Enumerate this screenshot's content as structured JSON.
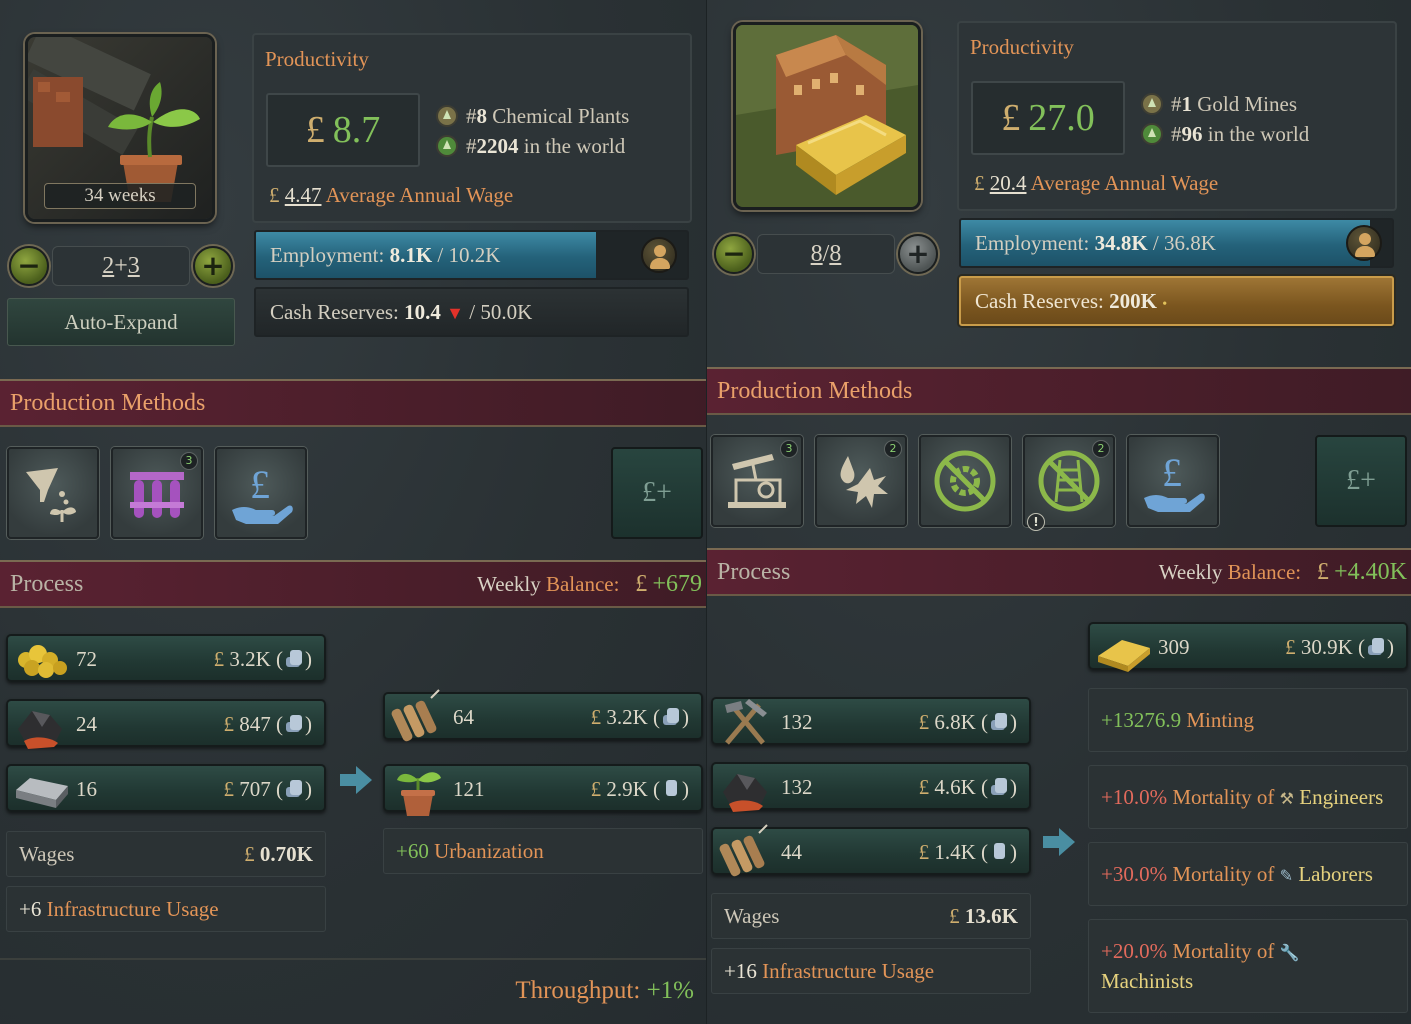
{
  "left": {
    "building_weeks": "34 weeks",
    "level_base": "2",
    "level_sep": "+",
    "level_extra": "3",
    "auto_expand": "Auto-Expand",
    "productivity": {
      "title": "Productivity",
      "currency": "£",
      "value": "8.7",
      "rank_prefix": "#",
      "rank1": "8",
      "rank1_label": "Chemical Plants",
      "rank2": "2204",
      "rank2_label": "in the world",
      "wage_value": "4.47",
      "wage_label": "Average Annual Wage"
    },
    "employment": {
      "label": "Employment:",
      "current": "8.1K",
      "max": "/ 10.2K",
      "fill_fraction": 0.79
    },
    "cash": {
      "label": "Cash Reserves:",
      "current": "10.4",
      "max": "/ 50.0K"
    },
    "production_methods_title": "Production Methods",
    "pm_badges": [
      "3"
    ],
    "process": {
      "title": "Process",
      "balance_label": "Weekly",
      "balance_label2": "Balance:",
      "balance_value": "+679"
    },
    "inputs": [
      {
        "icon": "sulfur-icon",
        "qty": "72",
        "price": "3.2K"
      },
      {
        "icon": "coal-icon",
        "qty": "24",
        "price": "847"
      },
      {
        "icon": "iron-icon",
        "qty": "16",
        "price": "707"
      }
    ],
    "outputs": [
      {
        "icon": "explosives-icon",
        "qty": "64",
        "price": "3.2K"
      },
      {
        "icon": "fertilizer-icon",
        "qty": "121",
        "price": "2.9K"
      }
    ],
    "wages_label": "Wages",
    "wages_value": "0.70K",
    "infra_value": "+6",
    "infra_label": "Infrastructure Usage",
    "urban_value": "+60",
    "urban_label": "Urbanization",
    "throughput_label": "Throughput:",
    "throughput_value": "+1%"
  },
  "right": {
    "level_base": "8",
    "level_sep": "/",
    "level_max": "8",
    "productivity": {
      "title": "Productivity",
      "currency": "£",
      "value": "27.0",
      "rank_prefix": "#",
      "rank1": "1",
      "rank1_label": "Gold Mines",
      "rank2": "96",
      "rank2_label": "in the world",
      "wage_value": "20.4",
      "wage_label": "Average Annual Wage"
    },
    "employment": {
      "label": "Employment:",
      "current": "34.8K",
      "max": "/ 36.8K",
      "fill_fraction": 0.95
    },
    "cash": {
      "label": "Cash Reserves:",
      "current": "200K"
    },
    "production_methods_title": "Production Methods",
    "pm_badges": [
      "3",
      "2",
      "2"
    ],
    "process": {
      "title": "Process",
      "balance_label": "Weekly",
      "balance_label2": "Balance:",
      "balance_value": "+4.40K"
    },
    "inputs": [
      {
        "icon": "tools-icon",
        "qty": "132",
        "price": "6.8K"
      },
      {
        "icon": "coal-icon",
        "qty": "132",
        "price": "4.6K"
      },
      {
        "icon": "explosives-icon",
        "qty": "44",
        "price": "1.4K"
      }
    ],
    "output": {
      "icon": "gold-icon",
      "qty": "309",
      "price": "30.9K"
    },
    "minting_value": "+13276.9",
    "minting_label": "Minting",
    "mortality": [
      {
        "value": "+10.0%",
        "label": "Mortality of",
        "pop": "Engineers",
        "icon": "engineer-icon"
      },
      {
        "value": "+30.0%",
        "label": "Mortality of",
        "pop": "Laborers",
        "icon": "shovel-icon"
      },
      {
        "value": "+20.0%",
        "label": "Mortality of",
        "pop": "Machinists",
        "icon": "wrench-icon"
      }
    ],
    "wages_label": "Wages",
    "wages_value": "13.6K",
    "infra_value": "+16",
    "infra_label": "Infrastructure Usage"
  },
  "currency": "£",
  "colors": {
    "accent_orange": "#e29457",
    "positive_green": "#82c05a",
    "negative_red": "#e26a5c",
    "teal_bar": "#3e8aa5",
    "gold_bar": "#9e7535"
  }
}
